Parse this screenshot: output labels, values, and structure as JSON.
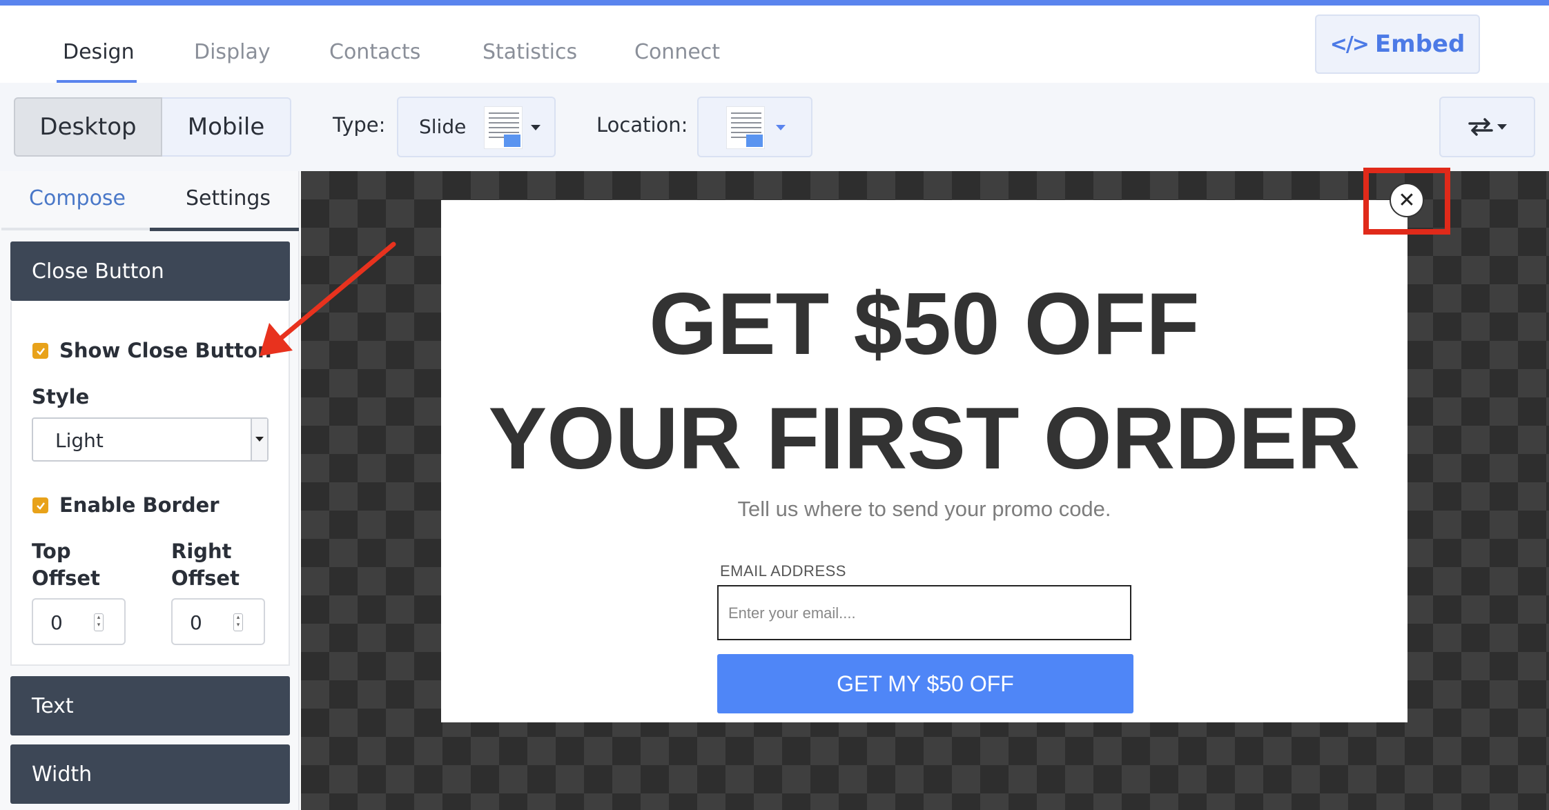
{
  "nav": {
    "tabs": [
      {
        "label": "Design",
        "active": true
      },
      {
        "label": "Display",
        "active": false
      },
      {
        "label": "Contacts",
        "active": false
      },
      {
        "label": "Statistics",
        "active": false
      },
      {
        "label": "Connect",
        "active": false
      }
    ],
    "embed_label": "Embed",
    "embed_icon": "code-icon"
  },
  "toolbar": {
    "device_options": [
      {
        "label": "Desktop",
        "selected": true
      },
      {
        "label": "Mobile",
        "selected": false
      }
    ],
    "type_label": "Type:",
    "type_value": "Slide",
    "type_icon": "slide-layout-icon",
    "location_label": "Location:",
    "location_icon": "location-layout-icon",
    "swap_icon": "swap-arrows-icon"
  },
  "sidebar": {
    "tabs": [
      {
        "label": "Compose",
        "active": true
      },
      {
        "label": "Settings",
        "active": false
      }
    ],
    "close_section": {
      "title": "Close Button",
      "show_close_label": "Show Close Button",
      "show_close_checked": true,
      "style_label": "Style",
      "style_value": "Light",
      "enable_border_label": "Enable Border",
      "enable_border_checked": true,
      "top_offset_label_1": "Top",
      "top_offset_label_2": "Offset",
      "right_offset_label_1": "Right",
      "right_offset_label_2": "Offset",
      "top_offset_value": "0",
      "right_offset_value": "0"
    },
    "sections": [
      "Text",
      "Width"
    ]
  },
  "popup": {
    "headline_1": "GET $50 OFF",
    "headline_2": "YOUR FIRST ORDER",
    "subline": "Tell us where to send your promo code.",
    "email_label": "EMAIL ADDRESS",
    "email_placeholder": "Enter your email....",
    "cta_label": "GET MY $50 OFF",
    "close_glyph": "✕"
  },
  "colors": {
    "accent": "#5a84ee",
    "cta": "#4f86f7",
    "checkbox": "#e8a21a",
    "highlight": "#e02a1a",
    "section_header": "#3d4756"
  }
}
